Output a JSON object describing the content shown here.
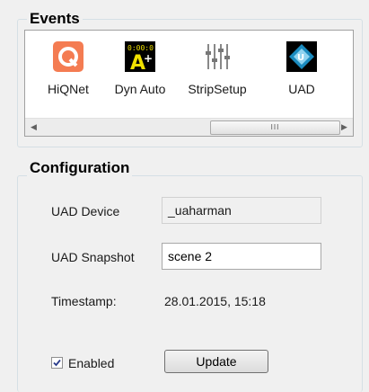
{
  "events": {
    "title": "Events",
    "items": [
      {
        "label": "HiQNet",
        "icon": "hiqnet-icon",
        "color": "#f47c52"
      },
      {
        "label": "Dyn Auto",
        "icon": "dyn-auto-icon",
        "color": "#f0e000"
      },
      {
        "label": "StripSetup",
        "icon": "strip-setup-icon",
        "color": "#6a6a6a"
      },
      {
        "label": "UAD",
        "icon": "uad-icon",
        "color": "#1b8bbf"
      }
    ],
    "scroll_left": "◀",
    "scroll_right": "▶",
    "scroll_thumb_grip": "III"
  },
  "configuration": {
    "title": "Configuration",
    "uad_device_label": "UAD Device",
    "uad_device_value": "_uaharman",
    "uad_snapshot_label": "UAD Snapshot",
    "uad_snapshot_value": "scene 2",
    "timestamp_label": "Timestamp:",
    "timestamp_value": "28.01.2015, 15:18",
    "enabled_label": "Enabled",
    "enabled_checked": true,
    "update_label": "Update"
  }
}
